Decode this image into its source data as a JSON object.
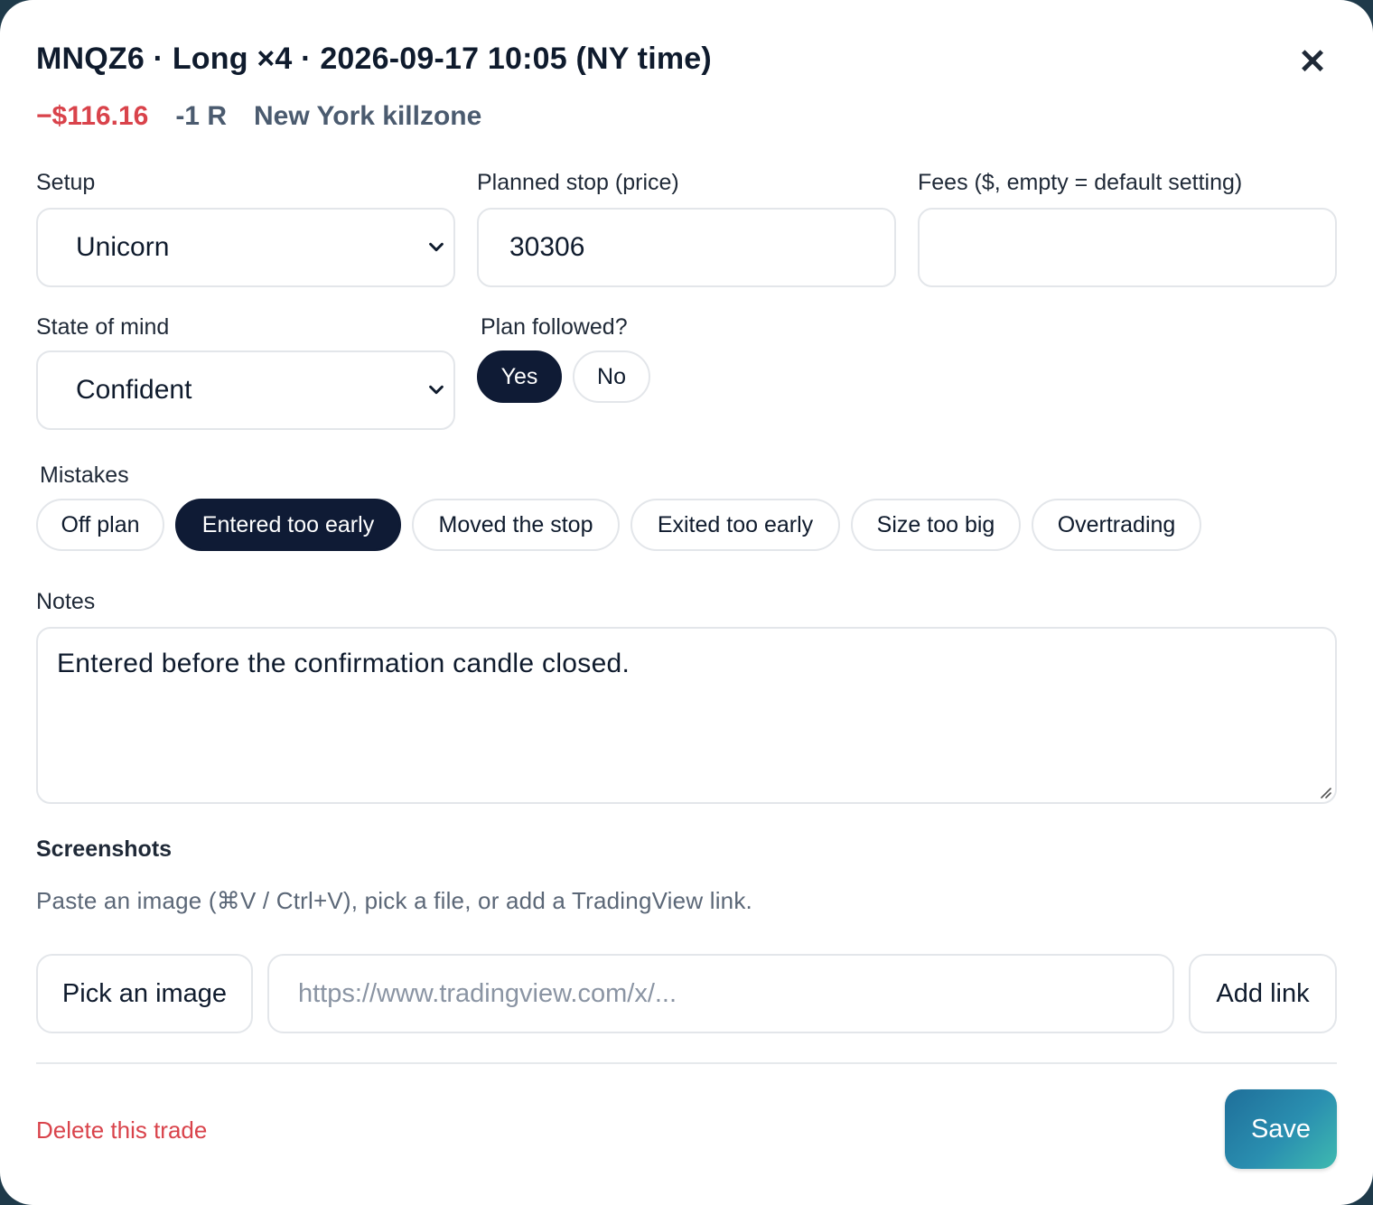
{
  "header": {
    "title": "MNQZ6 · Long ×4 · 2026-09-17 10:05 (NY time)",
    "pnl": "−$116.16",
    "r_multiple": "-1 R",
    "session": "New York killzone",
    "close_icon": "close-icon"
  },
  "setup": {
    "label": "Setup",
    "value": "Unicorn"
  },
  "planned_stop": {
    "label": "Planned stop (price)",
    "value": "30306"
  },
  "fees": {
    "label": "Fees ($, empty = default setting)",
    "value": ""
  },
  "state_of_mind": {
    "label": "State of mind",
    "value": "Confident"
  },
  "plan_followed": {
    "label": "Plan followed?",
    "yes": "Yes",
    "no": "No",
    "selected": "Yes"
  },
  "mistakes": {
    "label": "Mistakes",
    "chips": [
      {
        "label": "Off plan",
        "selected": false
      },
      {
        "label": "Entered too early",
        "selected": true
      },
      {
        "label": "Moved the stop",
        "selected": false
      },
      {
        "label": "Exited too early",
        "selected": false
      },
      {
        "label": "Size too big",
        "selected": false
      },
      {
        "label": "Overtrading",
        "selected": false
      }
    ]
  },
  "notes": {
    "label": "Notes",
    "value": "Entered before the confirmation candle closed."
  },
  "screenshots": {
    "label": "Screenshots",
    "hint": "Paste an image (⌘V / Ctrl+V), pick a file, or add a TradingView link.",
    "pick_label": "Pick an image",
    "url_placeholder": "https://www.tradingview.com/x/...",
    "add_link_label": "Add link"
  },
  "footer": {
    "delete_label": "Delete this trade",
    "save_label": "Save"
  },
  "colors": {
    "loss": "#d9434b",
    "selected_chip": "#0f1b35",
    "save_gradient_start": "#1f6f9a",
    "save_gradient_end": "#3fbab0"
  }
}
